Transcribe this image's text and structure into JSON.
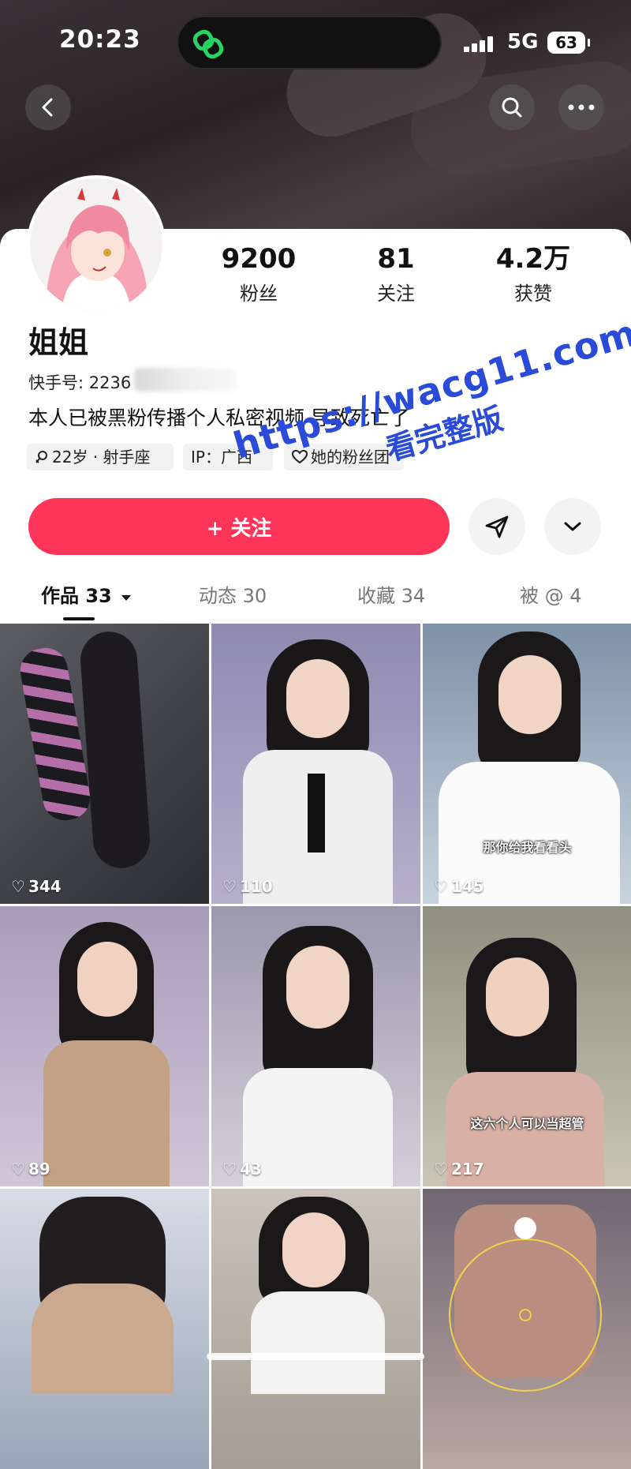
{
  "status_bar": {
    "time": "20:23",
    "network": "5G",
    "battery": "63"
  },
  "header": {
    "back_icon": "chevron-left-icon",
    "search_icon": "search-icon",
    "more_icon": "more-horizontal-icon"
  },
  "profile": {
    "name": "姐姐",
    "user_id_label": "快手号: 2236",
    "bio": "本人已被黑粉传播个人私密视频 导致死亡了",
    "stats": [
      {
        "value": "9200",
        "label": "粉丝"
      },
      {
        "value": "81",
        "label": "关注"
      },
      {
        "value": "4.2万",
        "label": "获赞"
      }
    ],
    "tags": [
      {
        "icon": "female-icon",
        "text": "22岁 · 射手座"
      },
      {
        "icon": "",
        "text": "IP：广西"
      },
      {
        "icon": "heart-outline-icon",
        "text": "她的粉丝团"
      }
    ]
  },
  "actions": {
    "follow_label": "+ 关注",
    "share_icon": "send-icon",
    "more_icon": "chevron-down-icon"
  },
  "tabs": [
    {
      "label": "作品 33",
      "active": true
    },
    {
      "label": "动态 30",
      "active": false
    },
    {
      "label": "收藏 34",
      "active": false
    },
    {
      "label": "被 @ 4",
      "active": false
    }
  ],
  "watermark": {
    "line1": "https://wacg11.com",
    "line2": "看完整版"
  },
  "videos": [
    {
      "likes": "344",
      "subtitle": ""
    },
    {
      "likes": "110",
      "subtitle": ""
    },
    {
      "likes": "145",
      "subtitle": "那你给我看看头"
    },
    {
      "likes": "89",
      "subtitle": ""
    },
    {
      "likes": "43",
      "subtitle": ""
    },
    {
      "likes": "217",
      "subtitle": "这六个人可以当超管"
    },
    {
      "likes": "",
      "subtitle": ""
    },
    {
      "likes": "",
      "subtitle": ""
    },
    {
      "likes": "",
      "subtitle": ""
    }
  ],
  "colors": {
    "accent": "#fe3559",
    "watermark": "#2a4bd8"
  }
}
